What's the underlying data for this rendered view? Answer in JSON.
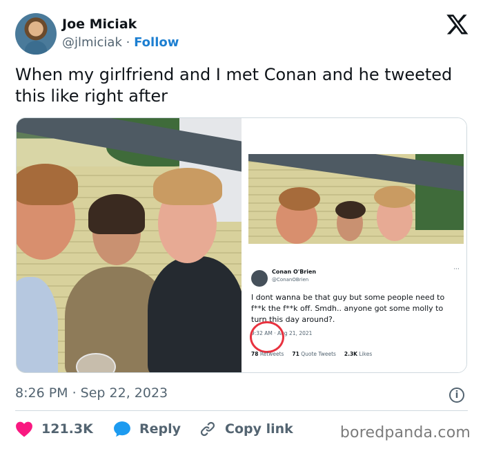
{
  "author": {
    "name": "Joe Miciak",
    "handle": "@jlmiciak",
    "separator": "·",
    "follow_label": "Follow"
  },
  "tweet": {
    "text": "When my girlfriend and I met Conan and he tweeted this like right after",
    "timestamp": "8:26 PM · Sep 22, 2023"
  },
  "embedded_tweet": {
    "name": "Conan O'Brien",
    "handle": "@ConanOBrien",
    "more": "···",
    "text": "I dont wanna be that guy but some people need to f**k the f**k off. Smdh.. anyone got some molly to turn this day around?.",
    "time": "9:32 AM · Aug 21, 2021",
    "retweets_count": "78",
    "retweets_label": "Retweets",
    "quotes_count": "71",
    "quotes_label": "Quote Tweets",
    "likes_count": "2.3K",
    "likes_label": "Likes"
  },
  "actions": {
    "like_count": "121.3K",
    "reply_label": "Reply",
    "copy_label": "Copy link"
  },
  "watermark": "boredpanda.com",
  "colors": {
    "like": "#f91880",
    "reply": "#1d9bf0",
    "follow": "#1d7fd1",
    "highlight_circle": "#e8323f"
  },
  "icons": {
    "platform": "x-logo-icon",
    "like": "heart-icon",
    "reply": "speech-bubble-icon",
    "copy": "link-icon",
    "info": "info-icon"
  }
}
